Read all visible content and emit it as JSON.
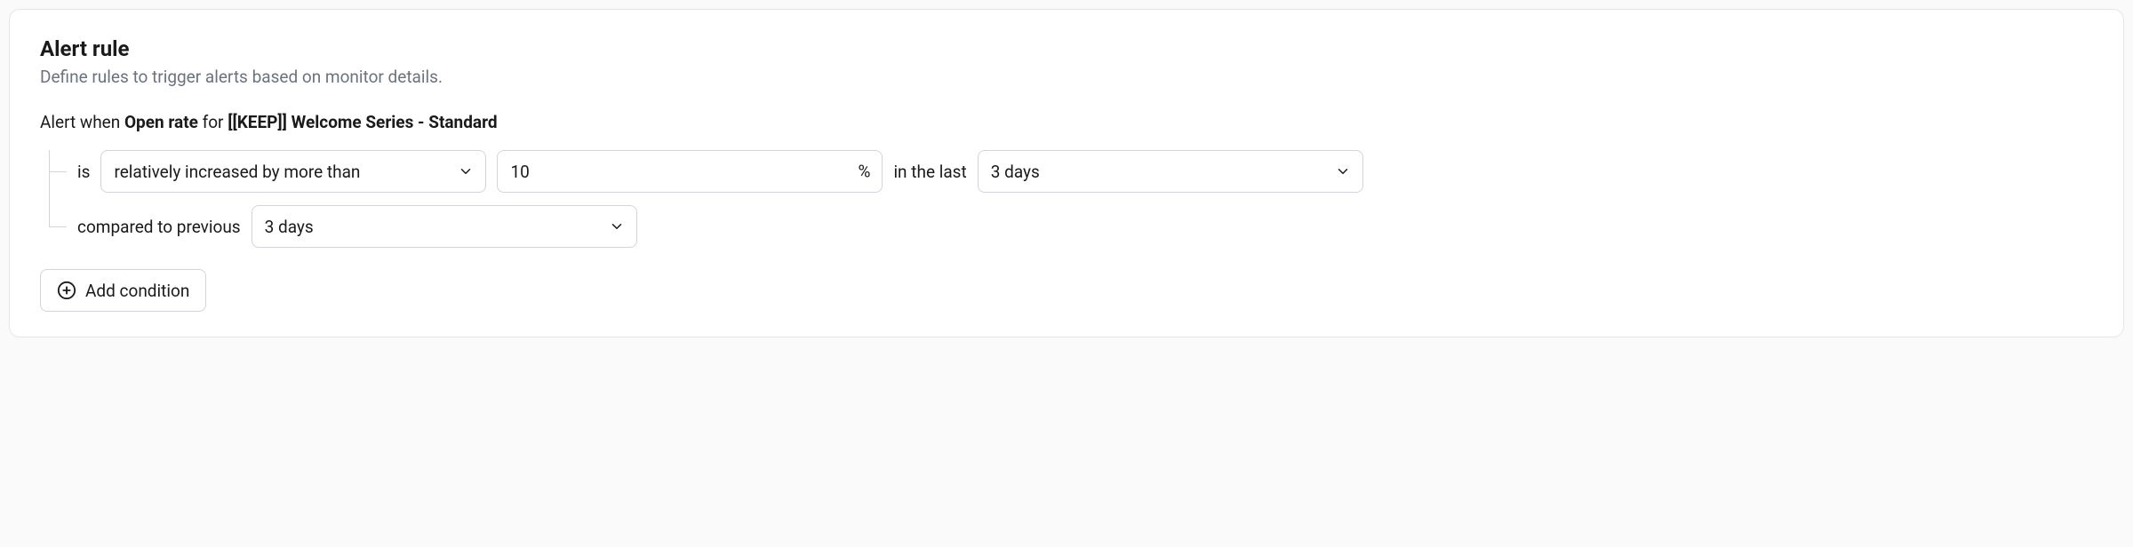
{
  "card": {
    "title": "Alert rule",
    "subtitle": "Define rules to trigger alerts based on monitor details."
  },
  "sentence": {
    "prefix": "Alert when ",
    "metric": "Open rate",
    "middle": " for ",
    "target": "[[KEEP]] Welcome Series - Standard"
  },
  "row1": {
    "is_label": "is",
    "operator_value": "relatively increased by more than",
    "amount_value": "10",
    "amount_suffix": "%",
    "in_the_last_label": "in the last",
    "timewindow_value": "3 days"
  },
  "row2": {
    "compared_label": "compared to previous",
    "compare_value": "3 days"
  },
  "add_button": {
    "label": "Add condition"
  }
}
